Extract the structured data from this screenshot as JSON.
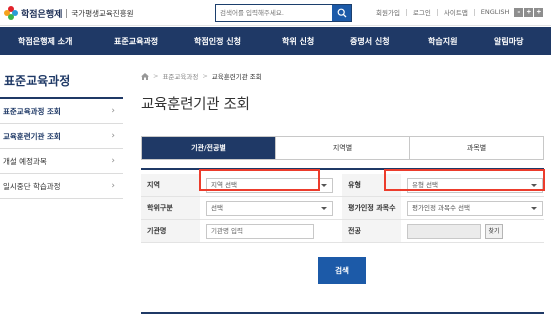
{
  "header": {
    "logo_main": "학점은행제",
    "logo_sub": "국가평생교육진흥원",
    "search_placeholder": "검색어를 입력해주세요.",
    "util_links": [
      "회원가입",
      "로그인",
      "사이트맵",
      "ENGLISH"
    ],
    "font_controls": [
      "-",
      "+",
      "+"
    ]
  },
  "gnb": {
    "items": [
      "학점은행제 소개",
      "표준교육과정",
      "학점인정 신청",
      "학위 신청",
      "증명서 신청",
      "학습지원",
      "알림마당"
    ]
  },
  "sidebar": {
    "title": "표준교육과정",
    "items": [
      {
        "label": "표준교육과정 조회",
        "chevron": "›"
      },
      {
        "label": "교육훈련기관 조회",
        "chevron": "›"
      },
      {
        "label": "개설 예정과목",
        "chevron": "›"
      },
      {
        "label": "일시중단 학습과정",
        "chevron": "›"
      }
    ]
  },
  "breadcrumb": {
    "items": [
      "표준교육과정",
      "교육훈련기관 조회"
    ],
    "separator": ">"
  },
  "page_title": "교육훈련기관 조회",
  "tabs": [
    "기관/전공별",
    "지역별",
    "과목별"
  ],
  "form": {
    "region_label": "지역",
    "region_value": "지역 선택",
    "type_label": "유형",
    "type_value": "유형 선택",
    "degree_label": "학위구분",
    "degree_value": "선택",
    "eval_label": "평가인정 과목수",
    "eval_value": "평가인정 과목수 선택",
    "inst_label": "기관명",
    "inst_placeholder": "기관명 입력",
    "major_label": "전공",
    "find_label": "찾기"
  },
  "search_button": "검색",
  "colors": {
    "navy": "#1f3966",
    "accent_blue": "#1c5aa8",
    "highlight_red": "#ec3c2c"
  }
}
